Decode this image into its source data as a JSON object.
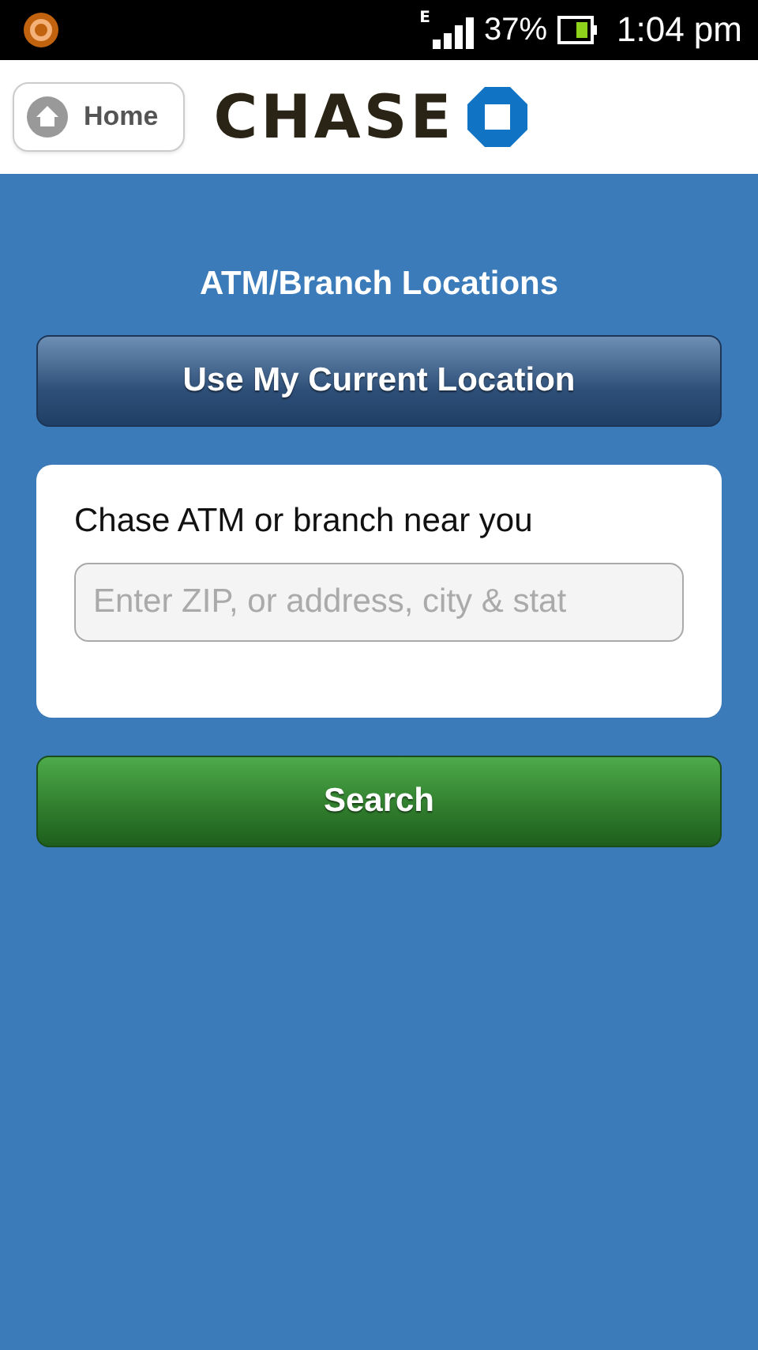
{
  "status_bar": {
    "network": "E",
    "battery": "37%",
    "time": "1:04 pm"
  },
  "header": {
    "home_button": "Home",
    "logo": "CHASE"
  },
  "page": {
    "title": "ATM/Branch Locations",
    "location_button": "Use My Current Location",
    "search_card": {
      "label": "Chase ATM or branch near you",
      "placeholder": "Enter ZIP, or address, city & stat"
    },
    "search_button": "Search"
  }
}
